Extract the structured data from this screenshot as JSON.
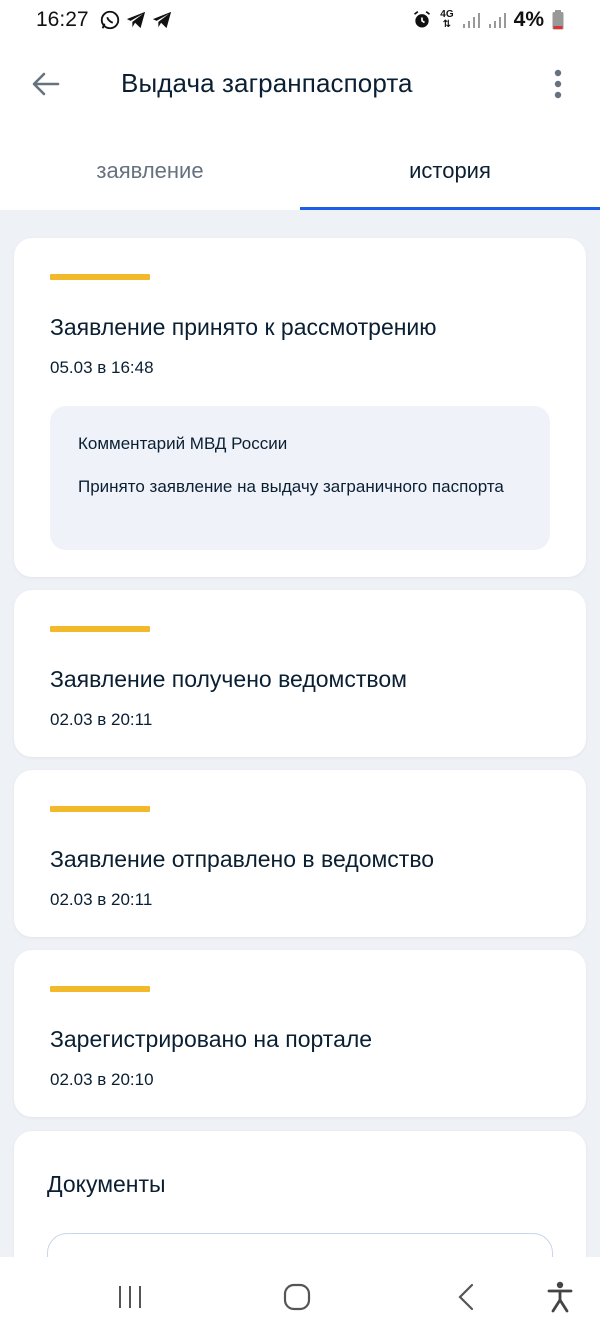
{
  "status_bar": {
    "time": "16:27",
    "battery": "4%",
    "network": "4G"
  },
  "header": {
    "title": "Выдача загранпаспорта"
  },
  "tabs": [
    {
      "label": "заявление",
      "active": false
    },
    {
      "label": "история",
      "active": true
    }
  ],
  "history": [
    {
      "title": "Заявление принято к рассмотрению",
      "date": "05.03 в 16:48",
      "comment": {
        "author": "Комментарий МВД России",
        "text": "Принято заявление на выдачу заграничного паспорта"
      }
    },
    {
      "title": "Заявление получено ведомством",
      "date": "02.03 в 20:11"
    },
    {
      "title": "Заявление отправлено в ведомство",
      "date": "02.03 в 20:11"
    },
    {
      "title": "Зарегистрировано на портале",
      "date": "02.03 в 20:10"
    }
  ],
  "documents": {
    "title": "Документы"
  },
  "colors": {
    "accent": "#f2b92a",
    "tab_underline": "#1d5deb",
    "background": "#eef1f6",
    "comment_bg": "#eff3f9"
  }
}
